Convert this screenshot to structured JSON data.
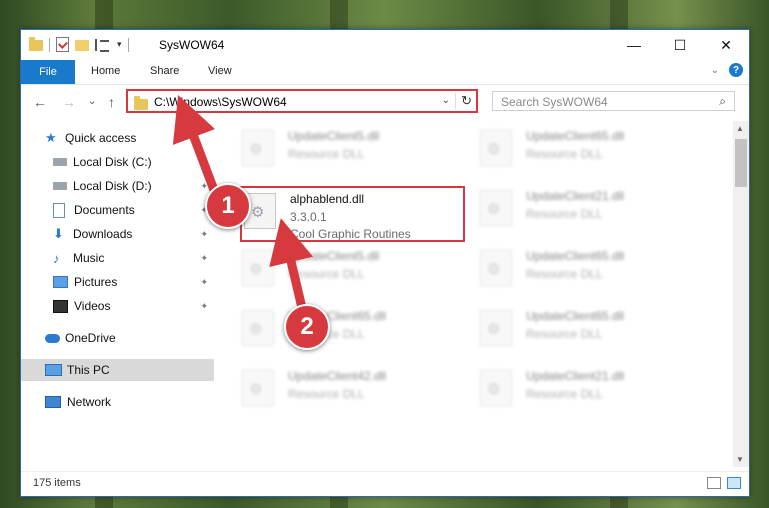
{
  "window": {
    "title": "SysWOW64",
    "controls": {
      "minimize": "—",
      "maximize": "☐",
      "close": "✕"
    }
  },
  "ribbon": {
    "file": "File",
    "tabs": [
      "Home",
      "Share",
      "View"
    ],
    "expand": "⌄",
    "help": "?"
  },
  "nav": {
    "back": "←",
    "forward": "→",
    "recent": "⌄",
    "up": "↑",
    "address": "C:\\Windows\\SysWOW64",
    "address_dropdown": "⌄",
    "refresh": "↻",
    "search_placeholder": "Search SysWOW64",
    "search_icon": "search-icon"
  },
  "sidebar": {
    "items": [
      {
        "label": "Quick access",
        "icon": "star-icon"
      },
      {
        "label": "Local Disk (C:)",
        "icon": "disk-icon",
        "pinned": true
      },
      {
        "label": "Local Disk (D:)",
        "icon": "disk-icon",
        "pinned": true
      },
      {
        "label": "Documents",
        "icon": "documents-icon",
        "pinned": true
      },
      {
        "label": "Downloads",
        "icon": "download-icon",
        "pinned": true
      },
      {
        "label": "Music",
        "icon": "music-icon",
        "pinned": true
      },
      {
        "label": "Pictures",
        "icon": "pictures-icon",
        "pinned": true
      },
      {
        "label": "Videos",
        "icon": "videos-icon",
        "pinned": true
      },
      {
        "label": "OneDrive",
        "icon": "onedrive-icon"
      },
      {
        "label": "This PC",
        "icon": "this-pc-icon",
        "selected": true
      },
      {
        "label": "Network",
        "icon": "network-icon"
      }
    ],
    "pin_glyph": "📌"
  },
  "files": {
    "blurred": [
      {
        "name": "UpdateClient5.dll",
        "type": "Resource DLL"
      },
      {
        "name": "UpdateClient65.dll",
        "type": "Resource DLL"
      },
      {
        "name": "UpdateClient21.dll",
        "type": "Resource DLL"
      },
      {
        "name": "UpdateClient5.dll",
        "type": "Resource DLL"
      },
      {
        "name": "UpdateClient65.dll",
        "type": "Resource DLL"
      },
      {
        "name": "UpdateClient65.dll",
        "type": "Resource DLL"
      },
      {
        "name": "UpdateClient65.dll",
        "type": "Resource DLL"
      },
      {
        "name": "UpdateClient42.dll",
        "type": "Resource DLL"
      },
      {
        "name": "UpdateClient21.dll",
        "type": "Resource DLL"
      }
    ],
    "highlighted": {
      "name": "alphablend.dll",
      "version": "3.3.0.1",
      "description": "Cool Graphic Routines"
    }
  },
  "status": {
    "count": "175 items"
  },
  "annotations": {
    "step1": "1",
    "step2": "2",
    "color": "#d63a3f"
  },
  "colors": {
    "accent": "#1979ca",
    "highlight": "#d9363e"
  }
}
